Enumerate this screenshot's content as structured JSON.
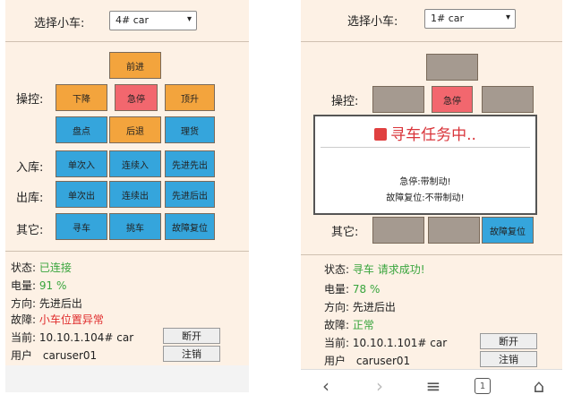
{
  "left": {
    "select_label": "选择小车:",
    "select_value": "4# car",
    "control_label": "操控:",
    "btn_forward": "前进",
    "btn_down": "下降",
    "btn_estop": "急停",
    "btn_up": "顶升",
    "btn_inventory": "盘点",
    "btn_back": "后退",
    "btn_tally": "理货",
    "store_label": "入库:",
    "btn_single_in": "单次入",
    "btn_cont_in": "连续入",
    "btn_fifo_in": "先进先出",
    "out_label": "出库:",
    "btn_single_out": "单次出",
    "btn_cont_out": "连续出",
    "btn_filo_out": "先进后出",
    "other_label": "其它:",
    "btn_find": "寻车",
    "btn_move": "挑车",
    "btn_reset": "故障复位",
    "status_label": "状态:",
    "status_value": "已连接",
    "power_label": "电量:",
    "power_value": "91 %",
    "dir_label": "方向:",
    "dir_value": "先进后出",
    "fault_label": "故障:",
    "fault_value": "小车位置异常",
    "current_label": "当前:",
    "current_value": "10.10.1.104# car",
    "user_label": "用户",
    "user_value": "caruser01",
    "disconnect": "断开",
    "logout": "注销"
  },
  "right": {
    "select_label": "选择小车:",
    "select_value": "1# car",
    "control_label": "操控:",
    "btn_estop": "急停",
    "other_label": "其它:",
    "btn_reset": "故障复位",
    "status_label": "状态:",
    "status_value": "寻车 请求成功!",
    "power_label": "电量:",
    "power_value": "78 %",
    "dir_label": "方向:",
    "dir_value": "先进后出",
    "fault_label": "故障:",
    "fault_value": "正常",
    "current_label": "当前:",
    "current_value": "10.10.1.101# car",
    "user_label": "用户",
    "user_value": "caruser01",
    "disconnect": "断开",
    "logout": "注销"
  },
  "modal": {
    "title": "寻车任务中..",
    "line1": "急停:带制动!",
    "line2": "故障复位:不带制动!"
  },
  "icons": {
    "dropdown": "▾",
    "back": "‹",
    "forward": "›",
    "menu": "≡",
    "tabs": "1",
    "home": "⌂"
  },
  "colors": {
    "orange": "#f3a43d",
    "red": "#f2676e",
    "blue": "#35a5dc",
    "green": "#39a53d",
    "alert": "#e02c2c"
  }
}
